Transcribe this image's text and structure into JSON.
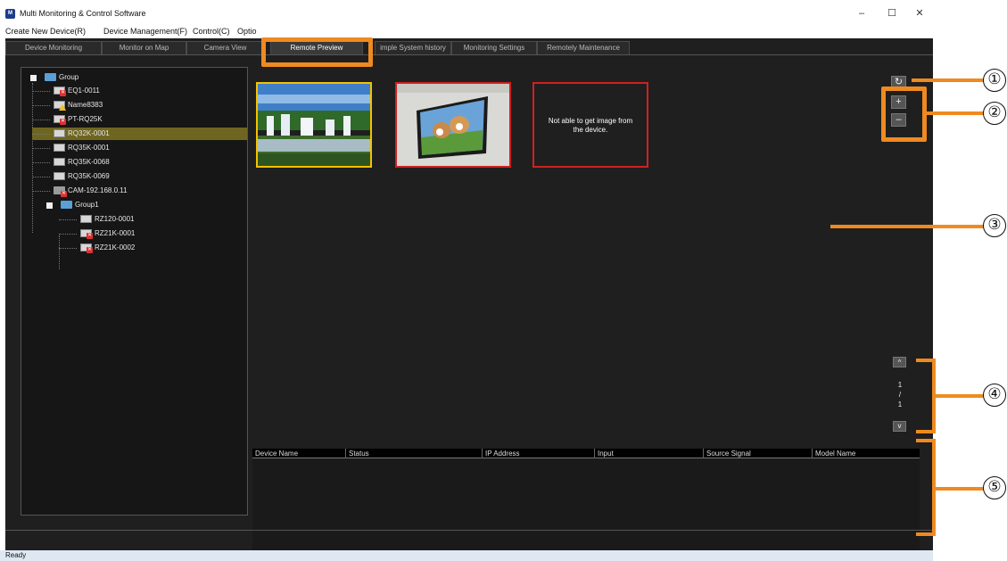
{
  "window": {
    "title": "Multi Monitoring & Control Software",
    "icon_text": "M",
    "minimize": "–",
    "maximize": "☐",
    "close": "✕"
  },
  "menu": [
    {
      "label": "Create New Device(R)"
    },
    {
      "label": "Device Management(F)"
    },
    {
      "label": "Control(C)"
    },
    {
      "label": "Optio"
    }
  ],
  "tabs": [
    {
      "label": "Device Monitoring"
    },
    {
      "label": "Monitor on Map"
    },
    {
      "label": "Camera View"
    },
    {
      "label": "Remote Preview",
      "active": true
    },
    {
      "label": "imple System history"
    },
    {
      "label": "Monitoring Settings"
    },
    {
      "label": "Remotely Maintenance"
    }
  ],
  "tree": [
    {
      "label": "Group",
      "icon": "folder-icon"
    },
    {
      "label": "EQ1-0011",
      "icon": "projector-icon",
      "status": "error"
    },
    {
      "label": "Name8383",
      "icon": "projector-icon",
      "status": "warning"
    },
    {
      "label": "PT-RQ25K",
      "icon": "projector-icon",
      "status": "error"
    },
    {
      "label": "RQ32K-0001",
      "icon": "projector-icon",
      "selected": true
    },
    {
      "label": "RQ35K-0001",
      "icon": "projector-icon"
    },
    {
      "label": "RQ35K-0068",
      "icon": "projector-icon"
    },
    {
      "label": "RQ35K-0069",
      "icon": "projector-icon"
    },
    {
      "label": "CAM-192.168.0.11",
      "icon": "camera-icon",
      "status": "error"
    },
    {
      "label": "Group1",
      "icon": "folder-icon"
    },
    {
      "label": "RZ120-0001",
      "icon": "projector-icon"
    },
    {
      "label": "RZ21K-0001",
      "icon": "projector-icon",
      "status": "error"
    },
    {
      "label": "RZ21K-0002",
      "icon": "projector-icon",
      "status": "error"
    }
  ],
  "previews": [
    {
      "name": "waterfall-preview",
      "border": "#f2c200"
    },
    {
      "name": "dogs-preview",
      "border": "#d02020"
    },
    {
      "name": "error-preview",
      "border": "#d02020",
      "message": "Not able to get image from the device."
    }
  ],
  "controls": {
    "refresh": "↻",
    "zoom_in": "+",
    "zoom_out": "–",
    "page_up": "^",
    "page_down": "v"
  },
  "pagination": {
    "current": "1",
    "separator": "/",
    "total": "1"
  },
  "table": {
    "columns": [
      "Device Name",
      "Status",
      "IP Address",
      "Input",
      "Source Signal",
      "Model Name"
    ]
  },
  "status_bar": {
    "text": "Ready"
  },
  "callouts": [
    {
      "label": "①"
    },
    {
      "label": "②"
    },
    {
      "label": "③"
    },
    {
      "label": "④"
    },
    {
      "label": "⑤"
    }
  ],
  "colors": {
    "accent": "#ef8a20",
    "selection": "#6e6520",
    "error": "#e03030"
  }
}
